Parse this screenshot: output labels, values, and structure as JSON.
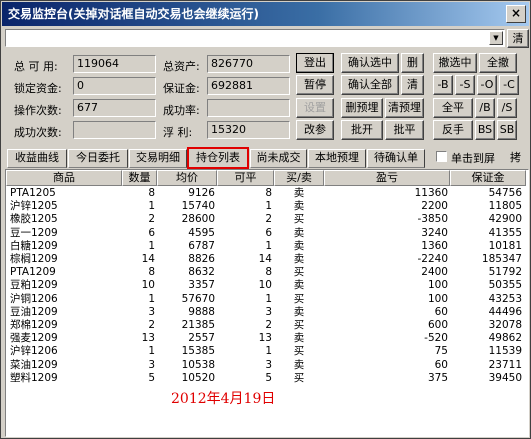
{
  "window": {
    "title": "交易监控台(关掉对话框自动交易也会继续运行)",
    "close": "×"
  },
  "toolbar": {
    "combo_value": "",
    "clear_label": "清"
  },
  "account": [
    {
      "label": "总 可 用:",
      "value": "119064"
    },
    {
      "label": "锁定资金:",
      "value": "0"
    },
    {
      "label": "操作次数:",
      "value": "677"
    },
    {
      "label": "成功次数:",
      "value": ""
    }
  ],
  "summary": [
    {
      "label": "总资产:",
      "value": "826770"
    },
    {
      "label": "保证金:",
      "value": "692881"
    },
    {
      "label": "成功率:",
      "value": ""
    },
    {
      "label": "浮  利:",
      "value": "15320"
    }
  ],
  "buttons": {
    "login": "登出",
    "pause": "暂停",
    "settings": "设置",
    "change_params": "改参",
    "confirm_selected": "确认选中",
    "confirm_all": "确认全部",
    "delete_pre": "删预埋",
    "batch_open": "批开",
    "del": "删",
    "clear": "清",
    "clear_pre": "清预埋",
    "batch_close": "批平",
    "cancel_selected": "撤选中",
    "cancel_all": "全撤",
    "minus_b": "-B",
    "minus_s": "-S",
    "minus_o": "-O",
    "minus_c": "-C",
    "close_all": "全平",
    "b_slash": "/B",
    "s_slash": "/S",
    "reverse": "反手",
    "bs": "BS",
    "sb": "SB"
  },
  "tabs": [
    "收益曲线",
    "今日委托",
    "交易明细",
    "持仓列表",
    "尚未成交",
    "本地预埋",
    "待确认单"
  ],
  "active_tab": "持仓列表",
  "single_screen": {
    "label": "单击到屏",
    "extra": "拷"
  },
  "table": {
    "headers": [
      "商品",
      "数量",
      "均价",
      "可平",
      "买/卖",
      "盈亏",
      "保证金"
    ],
    "rows": [
      [
        "PTA1205",
        "8",
        "9126",
        "8",
        "卖",
        "11360",
        "54756"
      ],
      [
        "沪锌1205",
        "1",
        "15740",
        "1",
        "卖",
        "2200",
        "11805"
      ],
      [
        "橡胶1205",
        "2",
        "28600",
        "2",
        "买",
        "-3850",
        "42900"
      ],
      [
        "豆一1209",
        "6",
        "4595",
        "6",
        "卖",
        "3240",
        "41355"
      ],
      [
        "白糖1209",
        "1",
        "6787",
        "1",
        "卖",
        "1360",
        "10181"
      ],
      [
        "棕榈1209",
        "14",
        "8826",
        "14",
        "卖",
        "-2240",
        "185347"
      ],
      [
        "PTA1209",
        "8",
        "8632",
        "8",
        "买",
        "2400",
        "51792"
      ],
      [
        "豆粕1209",
        "10",
        "3357",
        "10",
        "卖",
        "100",
        "50355"
      ],
      [
        "沪铜1206",
        "1",
        "57670",
        "1",
        "买",
        "100",
        "43253"
      ],
      [
        "豆油1209",
        "3",
        "9888",
        "3",
        "卖",
        "60",
        "44496"
      ],
      [
        "郑棉1209",
        "2",
        "21385",
        "2",
        "买",
        "600",
        "32078"
      ],
      [
        "强麦1209",
        "13",
        "2557",
        "13",
        "卖",
        "-520",
        "49862"
      ],
      [
        "沪锌1206",
        "1",
        "15385",
        "1",
        "买",
        "75",
        "11539"
      ],
      [
        "菜油1209",
        "3",
        "10538",
        "3",
        "卖",
        "60",
        "23711"
      ],
      [
        "塑料1209",
        "5",
        "10520",
        "5",
        "买",
        "375",
        "39450"
      ]
    ]
  },
  "date_stamp": "2012年4月19日"
}
